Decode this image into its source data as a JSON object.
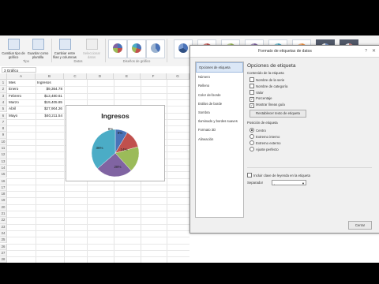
{
  "ribbon": {
    "buttons": [
      {
        "label": "Cambiar tipo de gráfico",
        "enabled": true
      },
      {
        "label": "Guardar como plantilla",
        "enabled": true
      },
      {
        "label": "Cambiar entre filas y columnas",
        "enabled": true
      },
      {
        "label": "Seleccionar datos",
        "enabled": false
      }
    ],
    "groups": {
      "tipo": "Tipo",
      "datos": "Datos",
      "disenos": "Diseños de gráfico"
    }
  },
  "formula_bar": {
    "name_box": "3 Gráfico"
  },
  "grid": {
    "columns": [
      "A",
      "B",
      "C",
      "D",
      "E",
      "F",
      "G"
    ],
    "rows": [
      "1",
      "2",
      "3",
      "4",
      "5",
      "6",
      "7",
      "8",
      "9",
      "10",
      "11",
      "12",
      "13",
      "14",
      "15",
      "16",
      "17",
      "18",
      "19",
      "20",
      "21",
      "22",
      "23",
      "24",
      "25",
      "26",
      "27",
      "28"
    ],
    "header_a": "Mes",
    "header_b": "Ingresos",
    "data": [
      {
        "month": "Enero",
        "value": "$9,364.78"
      },
      {
        "month": "Febrero",
        "value": "$13,480.61"
      },
      {
        "month": "Marzo",
        "value": "$19,405.85"
      },
      {
        "month": "Abril",
        "value": "$27,904.26"
      },
      {
        "month": "Mayo",
        "value": "$40,211.54"
      }
    ]
  },
  "chart": {
    "title": "Ingresos",
    "label_14": "14%",
    "label_28": "28%",
    "label_36": "36%",
    "label_mar": "8%",
    "label_apr": "9%"
  },
  "chart_data": {
    "type": "pie",
    "title": "Ingresos",
    "categories": [
      "Enero",
      "Febrero",
      "Marzo",
      "Abril",
      "Mayo"
    ],
    "values": [
      9364.78,
      13480.61,
      19405.85,
      27904.26,
      40211.54
    ],
    "colors": [
      "#4a73b8",
      "#c0504d",
      "#9bbb59",
      "#8064a2",
      "#4bacc6"
    ]
  },
  "dialog": {
    "title": "Formato de etiquetas de datos",
    "help": "?",
    "close": "✕",
    "nav": [
      "Opciones de etiqueta",
      "Número",
      "Relleno",
      "Color del borde",
      "Estilos de borde",
      "Sombra",
      "Iluminado y bordes suaves",
      "Formato 3D",
      "Alineación"
    ],
    "pane_title": "Opciones de etiqueta",
    "contents_label": "Contenido de la etiqueta",
    "checkboxes": [
      {
        "label": "Nombre de la serie",
        "checked": false
      },
      {
        "label": "Nombre de categoría",
        "checked": false
      },
      {
        "label": "Valor",
        "checked": false
      },
      {
        "label": "Porcentaje",
        "checked": true
      },
      {
        "label": "Mostrar líneas guía",
        "checked": true
      }
    ],
    "reset_button": "Restablecer texto de etiqueta",
    "position_label": "Posición de etiqueta",
    "radios": [
      {
        "label": "Centro",
        "checked": true
      },
      {
        "label": "Extremo interno",
        "checked": false
      },
      {
        "label": "Extremo externo",
        "checked": false
      },
      {
        "label": "Ajuste perfecto",
        "checked": false
      }
    ],
    "legend_key_label": "Incluir clave de leyenda en la etiqueta",
    "separator_label": "Separador",
    "separator_value": ",",
    "close_button": "Cerrar"
  }
}
